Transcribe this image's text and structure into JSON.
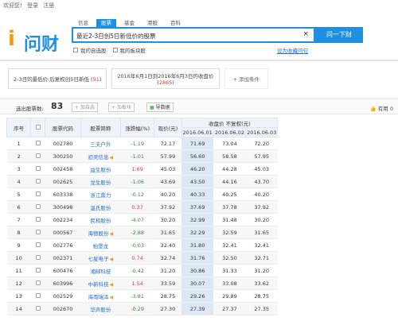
{
  "topbar": {
    "welcome": "欢迎您!",
    "login": "登录",
    "register": "注册"
  },
  "logo": {
    "glyph": "i",
    "word": "问财"
  },
  "tabs": [
    {
      "label": "信息",
      "active": false
    },
    {
      "label": "股票",
      "active": true
    },
    {
      "label": "基金",
      "active": false
    },
    {
      "label": "港股",
      "active": false
    },
    {
      "label": "百科",
      "active": false
    }
  ],
  "search": {
    "value": "最近2-3日创5日新低价的股票",
    "button": "问一下财",
    "clear": "×"
  },
  "checks": {
    "my_stocks": "我的自选股",
    "my_sectors": "我的板块股"
  },
  "save_link": "设为收藏问句",
  "conditions": [
    {
      "text": "2-3日的最低价:后复权创5日新低",
      "count": "91"
    },
    {
      "line1": "2016年6月1日到2016年6月3日的收盘价",
      "count": "2865"
    }
  ],
  "add_condition": "+ 添加条件",
  "toolbar": {
    "count_label": "选出股票数:",
    "count": "83",
    "add_favorite": "+ 加自选",
    "add_sector": "+ 加板块",
    "export": "导数据",
    "useful": "有用 0"
  },
  "table": {
    "headers": [
      "序号",
      "股票代码",
      "股票简称",
      "涨跌幅(%)",
      "现价(元)",
      "收盘价 不复权(元)"
    ],
    "sub_headers": [
      "2016.06.01",
      "2016.06.02",
      "2016.06.03"
    ],
    "rows": [
      {
        "no": "1",
        "code": "002780",
        "name": "三夫户外",
        "chg": "-1.19",
        "price": "72.17",
        "d1": "71.69",
        "d2": "73.04",
        "d3": "72.20",
        "spk": false
      },
      {
        "no": "2",
        "code": "300250",
        "name": "初灵信息",
        "chg": "-1.01",
        "price": "57.99",
        "d1": "56.60",
        "d2": "58.58",
        "d3": "57.95",
        "spk": true
      },
      {
        "no": "3",
        "code": "002458",
        "name": "益生股份",
        "chg": "1.69",
        "price": "45.03",
        "d1": "46.20",
        "d2": "44.28",
        "d3": "45.03",
        "spk": false
      },
      {
        "no": "4",
        "code": "002625",
        "name": "龙生股份",
        "chg": "-1.06",
        "price": "43.69",
        "d1": "43.50",
        "d2": "44.16",
        "d3": "43.70",
        "spk": false
      },
      {
        "no": "5",
        "code": "603338",
        "name": "浙江鼎力",
        "chg": "-0.12",
        "price": "40.20",
        "d1": "40.33",
        "d2": "40.25",
        "d3": "40.20",
        "spk": false
      },
      {
        "no": "6",
        "code": "300498",
        "name": "温氏股份",
        "chg": "0.37",
        "price": "37.92",
        "d1": "37.69",
        "d2": "37.78",
        "d3": "37.92",
        "spk": false
      },
      {
        "no": "7",
        "code": "002234",
        "name": "民和股份",
        "chg": "-4.07",
        "price": "30.20",
        "d1": "32.99",
        "d2": "31.48",
        "d3": "30.20",
        "spk": false
      },
      {
        "no": "8",
        "code": "000567",
        "name": "海德股份",
        "chg": "-2.88",
        "price": "31.65",
        "d1": "32.29",
        "d2": "32.59",
        "d3": "31.65",
        "spk": true
      },
      {
        "no": "9",
        "code": "002776",
        "name": "柏堡龙",
        "chg": "-0.03",
        "price": "32.40",
        "d1": "31.80",
        "d2": "32.41",
        "d3": "32.41",
        "spk": false
      },
      {
        "no": "10",
        "code": "002371",
        "name": "七星电子",
        "chg": "0.74",
        "price": "32.74",
        "d1": "31.76",
        "d2": "32.50",
        "d3": "32.71",
        "spk": true
      },
      {
        "no": "11",
        "code": "600476",
        "name": "湘邮科技",
        "chg": "-0.42",
        "price": "31.20",
        "d1": "30.86",
        "d2": "31.33",
        "d3": "31.20",
        "spk": false
      },
      {
        "no": "12",
        "code": "603996",
        "name": "中新科技",
        "chg": "1.54",
        "price": "33.59",
        "d1": "30.07",
        "d2": "33.08",
        "d3": "33.62",
        "spk": true
      },
      {
        "no": "13",
        "code": "002529",
        "name": "海南瑞泽",
        "chg": "-3.81",
        "price": "28.75",
        "d1": "29.26",
        "d2": "29.89",
        "d3": "28.75",
        "spk": true
      },
      {
        "no": "14",
        "code": "002670",
        "name": "华声股份",
        "chg": "-0.29",
        "price": "27.30",
        "d1": "27.39",
        "d2": "27.37",
        "d3": "27.35",
        "spk": false
      }
    ]
  },
  "colors": {
    "accent": "#1e8fe1",
    "up": "#e4393c",
    "down": "#2e8b2e"
  }
}
